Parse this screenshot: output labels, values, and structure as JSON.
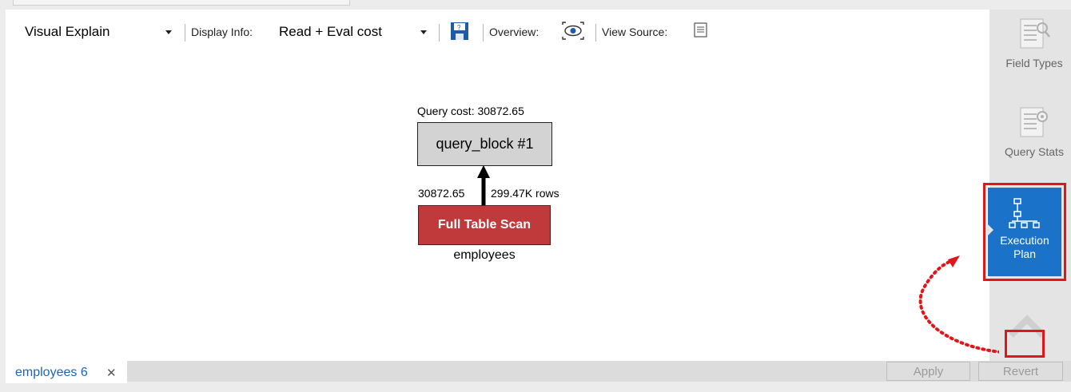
{
  "toolbar": {
    "view_mode": "Visual Explain",
    "display_info_label": "Display Info:",
    "display_info_value": "Read + Eval cost",
    "overview_label": "Overview:",
    "view_source_label": "View Source:"
  },
  "plan": {
    "query_cost_label": "Query cost: 30872.65",
    "query_block": "query_block #1",
    "edge_cost": "30872.65",
    "edge_rows": "299.47K rows",
    "access_type": "Full Table Scan",
    "table_name": "employees",
    "colors": {
      "query_block": "#d3d3d3",
      "full_table_scan": "#c0393b"
    }
  },
  "sidebar": {
    "field_types": "Field Types",
    "query_stats": "Query Stats",
    "execution_plan": "Execution Plan",
    "active_color": "#1a73c9",
    "highlight_color": "#e0161b"
  },
  "bottom": {
    "tab_label": "employees 6",
    "tab_close": "✕",
    "apply_label": "Apply",
    "revert_label": "Revert"
  }
}
